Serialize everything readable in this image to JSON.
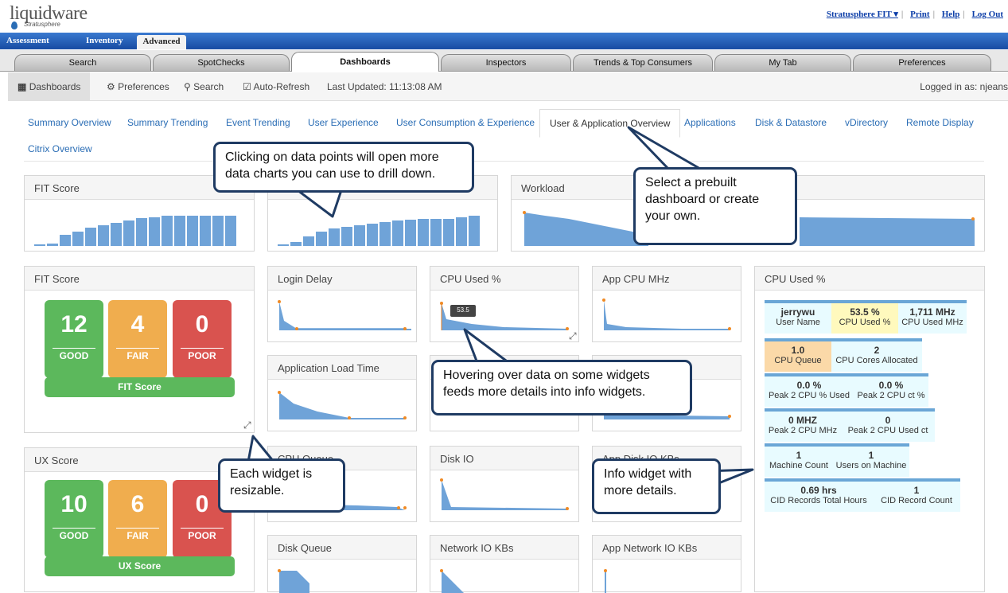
{
  "header": {
    "logo": "liquidware",
    "logo_sub": "Stratusphere",
    "links": [
      "Stratusphere FIT ▾",
      "Print",
      "Help",
      "Log Out"
    ]
  },
  "nav": {
    "items": [
      "Assessment",
      "Inventory",
      "Advanced"
    ]
  },
  "tabs": [
    "Search",
    "SpotChecks",
    "Dashboards",
    "Inspectors",
    "Trends & Top Consumers",
    "My Tab",
    "Preferences"
  ],
  "toolbar": {
    "dashboards": "Dashboards",
    "preferences": "Preferences",
    "search": "Search",
    "auto_refresh": "Auto-Refresh",
    "last_updated": "Last Updated: 11:13:08 AM",
    "logged_in": "Logged in as: njeans"
  },
  "subnav": [
    "Summary Overview",
    "Summary Trending",
    "Event Trending",
    "User Experience",
    "User Consumption & Experience",
    "User & Application Overview",
    "Applications",
    "Disk & Datastore",
    "vDirectory",
    "Remote Display",
    "Citrix Overview"
  ],
  "widgets": {
    "fit_top": "FIT Score",
    "workload": "Workload",
    "fit_score": "FIT Score",
    "ux_score": "UX Score",
    "login_delay": "Login Delay",
    "cpu_used": "CPU Used %",
    "app_cpu": "App CPU MHz",
    "app_load": "Application Load Time",
    "cpu_queue": "CPU Queue",
    "disk_io": "Disk IO",
    "app_disk_io": "App Disk IO KBs",
    "disk_queue": "Disk Queue",
    "network_io": "Network IO KBs",
    "app_network_io": "App Network IO KBs",
    "info_title": "CPU Used %"
  },
  "fit": {
    "good": "12",
    "fair": "4",
    "poor": "0",
    "good_label": "GOOD",
    "fair_label": "FAIR",
    "poor_label": "POOR",
    "bar": "FIT Score"
  },
  "ux": {
    "good": "10",
    "fair": "6",
    "poor": "0",
    "good_label": "GOOD",
    "fair_label": "FAIR",
    "poor_label": "POOR",
    "bar": "UX Score"
  },
  "tooltip": "53.5",
  "info": [
    {
      "v": "jerrywu",
      "l": "User Name"
    },
    {
      "v": "53.5 %",
      "l": "CPU Used %"
    },
    {
      "v": "1,711 MHz",
      "l": "CPU Used MHz"
    },
    {
      "v": "1.0",
      "l": "CPU Queue"
    },
    {
      "v": "2",
      "l": "CPU Cores Allocated"
    },
    {
      "v": "0.0 %",
      "l": "Peak 2 CPU % Used"
    },
    {
      "v": "0.0 %",
      "l": "Peak 2 CPU ct %"
    },
    {
      "v": "0 MHZ",
      "l": "Peak 2 CPU MHz"
    },
    {
      "v": "0",
      "l": "Peak 2 CPU Used ct"
    },
    {
      "v": "1",
      "l": "Machine Count"
    },
    {
      "v": "1",
      "l": "Users on Machine"
    },
    {
      "v": "0.69 hrs",
      "l": "CID Records Total Hours"
    },
    {
      "v": "1",
      "l": "CID Record Count"
    }
  ],
  "callouts": {
    "drill": "Clicking on data points will open more data charts you can use to drill down.",
    "prebuilt": "Select a prebuilt dashboard or create your own.",
    "hover": "Hovering over data on some widgets feeds more details into info widgets.",
    "resize": "Each widget is resizable.",
    "info": "Info widget with more details."
  },
  "colors": {
    "accent": "#2a6db5",
    "good": "#5cb85c",
    "fair": "#f0ad4e",
    "poor": "#d9534f",
    "chart": "#6fa3d8"
  }
}
